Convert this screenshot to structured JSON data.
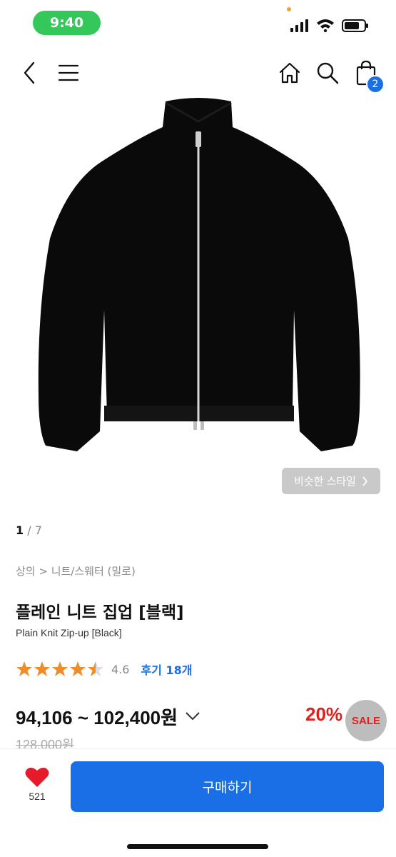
{
  "status_bar": {
    "time": "9:40"
  },
  "nav": {
    "cart_count": "2"
  },
  "image": {
    "current": "1",
    "total": "/ 7",
    "similar_style_label": "비슷한 스타일"
  },
  "product": {
    "breadcrumb": "상의 > 니트/스웨터 (밀로)",
    "title": "플레인 니트 집업 [블랙]",
    "subtitle": "Plain Knit Zip-up [Black]",
    "rating": "4.6",
    "review_label": "후기 18개",
    "price_range": "94,106 ~ 102,400원",
    "discount": "20%",
    "sale_label": "SALE",
    "original_price": "128,000원"
  },
  "bottom_bar": {
    "like_count": "521",
    "buy_label": "구매하기"
  },
  "colors": {
    "accent": "#1a6ee6",
    "discount": "#e02020",
    "star": "#f08c2a",
    "status_pill": "#34c759"
  }
}
